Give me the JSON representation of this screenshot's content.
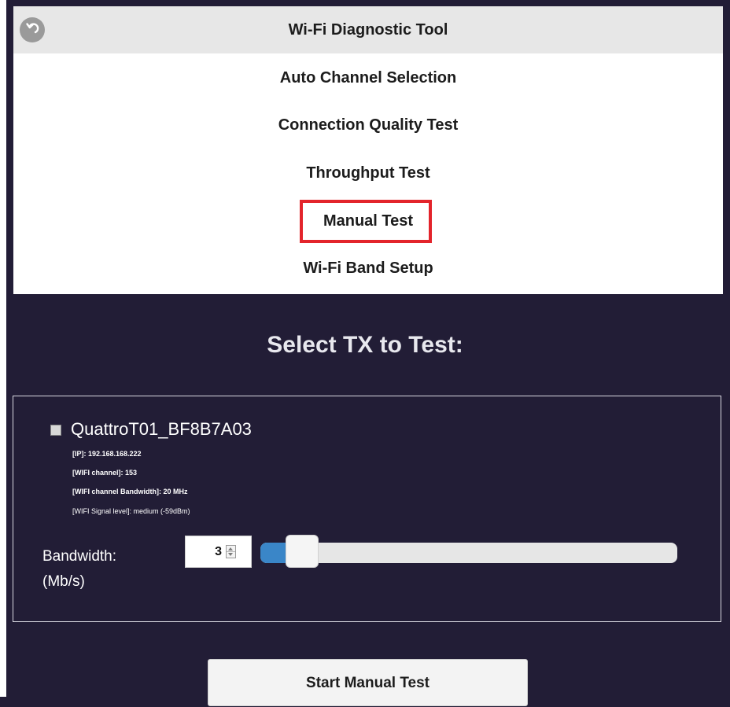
{
  "header": {
    "title": "Wi-Fi Diagnostic Tool",
    "back_icon": "back-arrow-icon"
  },
  "menu": {
    "items": [
      {
        "label": "Auto Channel Selection"
      },
      {
        "label": "Connection Quality Test"
      },
      {
        "label": "Throughput Test"
      },
      {
        "label": "Manual Test"
      },
      {
        "label": "Wi-Fi Band Setup"
      }
    ],
    "highlight_color": "#e3242b"
  },
  "section_title": "Select TX to Test:",
  "tx": {
    "checked": false,
    "name": "QuattroT01_BF8B7A03",
    "info": [
      "[IP]: 192.168.168.222",
      "[WIFI channel]: 153",
      "[WIFI channel Bandwidth]: 20 MHz",
      "[WIFI Signal level]: medium (-59dBm)"
    ]
  },
  "bandwidth": {
    "label_line1": "Bandwidth:",
    "label_line2": "(Mb/s)",
    "value": "3",
    "slider_fraction": 0.1
  },
  "start_button": {
    "label": "Start Manual Test"
  },
  "colors": {
    "background": "#221d36",
    "header_bg": "#e7e7e7",
    "menu_bg": "#ffffff",
    "slider_fill": "#3a86c8"
  }
}
